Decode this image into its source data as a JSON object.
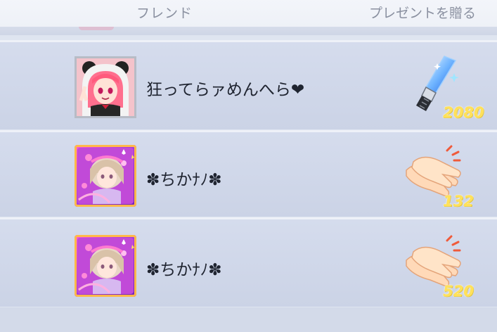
{
  "header": {
    "friend_label": "フレンド",
    "gift_label": "プレゼントを贈る"
  },
  "friends": [
    {
      "name": "狂ってらァめんへら❤︎",
      "avatar": "pink-hair-girl-panda-hood-avatar",
      "gift_icon": "glow-stick-icon",
      "gift_count": "2080"
    },
    {
      "name": "✽ちかﾅﾉ✽",
      "avatar": "purple-idol-card-avatar",
      "gift_icon": "clapping-hands-icon",
      "gift_count": "132"
    },
    {
      "name": "✽ちかﾅﾉ✽",
      "avatar": "purple-idol-card-avatar",
      "gift_icon": "clapping-hands-icon",
      "gift_count": "520"
    }
  ],
  "colors": {
    "row_background": "#cfd6e8",
    "count_text": "#ffe15a",
    "header_text": "#8a90a0"
  }
}
